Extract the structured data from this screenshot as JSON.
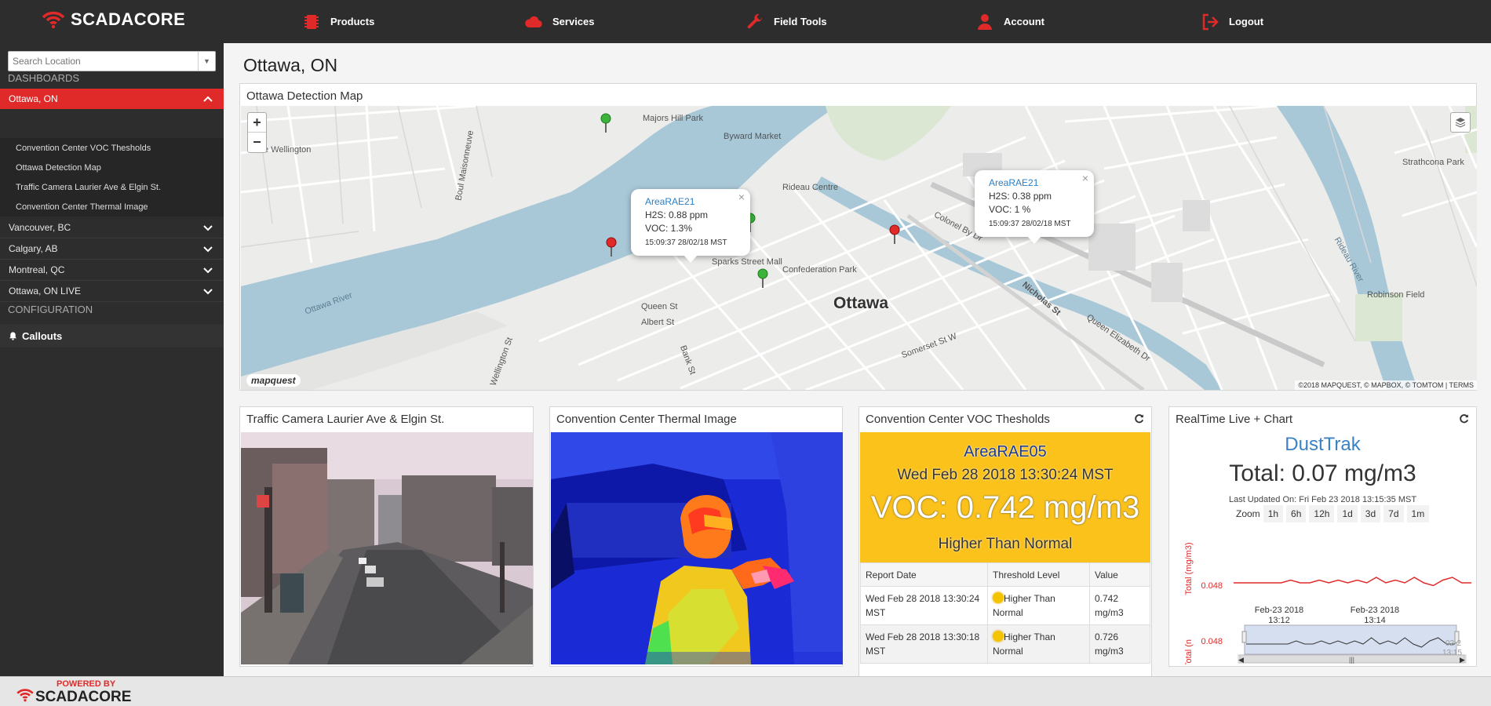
{
  "brand": {
    "name": "SCADACORE"
  },
  "nav": {
    "products": "Products",
    "services": "Services",
    "field_tools": "Field Tools",
    "account": "Account",
    "logout": "Logout"
  },
  "sidebar": {
    "search_placeholder": "Search Location",
    "dashboards_heading": "DASHBOARDS",
    "active_location": "Ottawa, ON",
    "subitems": [
      "Convention Center VOC Thesholds",
      "Ottawa Detection Map",
      "Traffic Camera Laurier Ave & Elgin St.",
      "Convention Center Thermal Image"
    ],
    "locations": [
      "Vancouver, BC",
      "Calgary, AB",
      "Montreal, QC",
      "Ottawa, ON LIVE"
    ],
    "configuration_heading": "CONFIGURATION",
    "callouts": "Callouts"
  },
  "page": {
    "title": "Ottawa, ON"
  },
  "map_panel": {
    "title": "Ottawa Detection Map",
    "zoom_in": "+",
    "zoom_out": "−",
    "city_label": "Ottawa",
    "logo": "mapquest",
    "attribution": "©2018 MAPQUEST, © MAPBOX, © TOMTOM | TERMS",
    "streets": [
      "Majors Hill Park",
      "Byward Market",
      "Rideau Centre",
      "Sparks Street Mall",
      "Confederation Park",
      "Colonel By Dr",
      "Nicholas St",
      "Queen Elizabeth Dr",
      "Ottawa River",
      "Rideau River",
      "Strathcona Park",
      "Robinson Field",
      "Wellington St",
      "Bank St",
      "Queen St",
      "Albert St",
      "Rue Wellington",
      "Boul Maisonneuve",
      "Somerset St W"
    ],
    "popups": [
      {
        "name": "AreaRAE21",
        "h2s": "H2S: 0.88 ppm",
        "voc": "VOC: 1.3%",
        "time": "15:09:37 28/02/18 MST"
      },
      {
        "name": "AreaRAE21",
        "h2s": "H2S: 0.38 ppm",
        "voc": "VOC: 1 %",
        "time": "15:09:37 28/02/18 MST"
      }
    ]
  },
  "camera_panel": {
    "title": "Traffic Camera Laurier Ave & Elgin St."
  },
  "thermal_panel": {
    "title": "Convention Center Thermal Image"
  },
  "voc_panel": {
    "title": "Convention Center VOC Thesholds",
    "area": "AreaRAE05",
    "datetime": "Wed Feb 28 2018 13:30:24 MST",
    "reading": "VOC: 0.742 mg/m3",
    "level": "Higher Than Normal",
    "table": {
      "headers": [
        "Report Date",
        "Threshold Level",
        "Value"
      ],
      "rows": [
        {
          "date": "Wed Feb 28 2018 13:30:24 MST",
          "level": "Higher Than Normal",
          "value": "0.742 mg/m3"
        },
        {
          "date": "Wed Feb 28 2018 13:30:18 MST",
          "level": "Higher Than Normal",
          "value": "0.726 mg/m3"
        }
      ]
    }
  },
  "realtime_panel": {
    "title": "RealTime Live + Chart",
    "device": "DustTrak",
    "total": "Total: 0.07 mg/m3",
    "last_updated": "Last Updated On: Fri Feb 23 2018 13:15:35 MST",
    "zoom_label": "Zoom",
    "zoom_options": [
      "1h",
      "6h",
      "12h",
      "1d",
      "3d",
      "7d",
      "1m"
    ],
    "navigator_ylabel": "Total (n",
    "navigator_endlabel": "02-2",
    "navigator_endlabel2": "13:15"
  },
  "chart_data": {
    "type": "line",
    "ylabel": "Total (mg/m3)",
    "x_ticks": [
      "Feb-23 2018 13:12",
      "Feb-23 2018 13:14"
    ],
    "y_ticks": [
      0.048
    ],
    "series": [
      {
        "color": "#e02a2a",
        "values": [
          0.048,
          0.048,
          0.048,
          0.048,
          0.048,
          0.048,
          0.049,
          0.048,
          0.048,
          0.049,
          0.048,
          0.049,
          0.048,
          0.049,
          0.048,
          0.05,
          0.048,
          0.049,
          0.048,
          0.05,
          0.048,
          0.047,
          0.049,
          0.05,
          0.048,
          0.048
        ]
      }
    ]
  },
  "footer": {
    "powered_by": "POWERED BY",
    "brand": "SCADACORE"
  },
  "colors": {
    "accent": "#e02a2a",
    "dark": "#2d2d2d",
    "voc_bg": "#fbc21b",
    "link": "#2a7fc4"
  }
}
